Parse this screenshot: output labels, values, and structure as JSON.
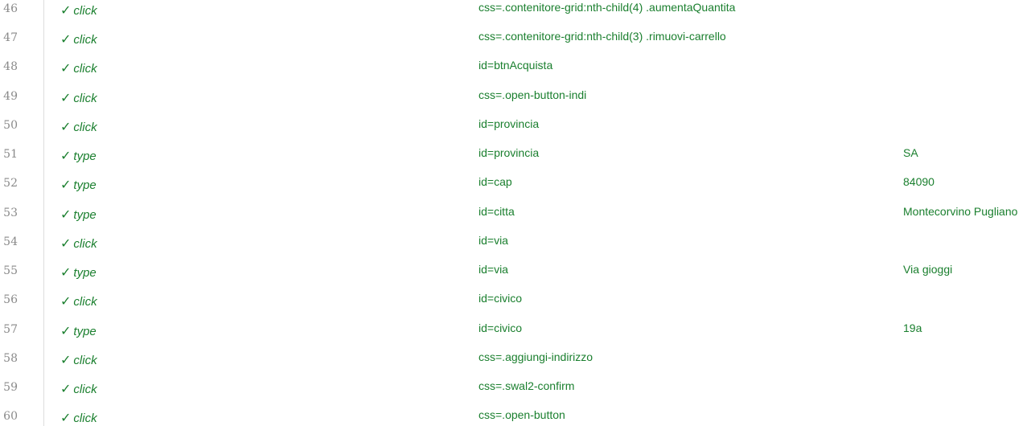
{
  "colors": {
    "pass_text": "#1a7f2e",
    "line_number": "#8a8a8a",
    "gutter_border": "#dddddd"
  },
  "rows": [
    {
      "line": "46",
      "status_icon": "checkmark-icon",
      "command": "click",
      "target": "css=.contenitore-grid:nth-child(4) .aumentaQuantita",
      "value": ""
    },
    {
      "line": "47",
      "status_icon": "checkmark-icon",
      "command": "click",
      "target": "css=.contenitore-grid:nth-child(3) .rimuovi-carrello",
      "value": ""
    },
    {
      "line": "48",
      "status_icon": "checkmark-icon",
      "command": "click",
      "target": "id=btnAcquista",
      "value": ""
    },
    {
      "line": "49",
      "status_icon": "checkmark-icon",
      "command": "click",
      "target": "css=.open-button-indi",
      "value": ""
    },
    {
      "line": "50",
      "status_icon": "checkmark-icon",
      "command": "click",
      "target": "id=provincia",
      "value": ""
    },
    {
      "line": "51",
      "status_icon": "checkmark-icon",
      "command": "type",
      "target": "id=provincia",
      "value": "SA"
    },
    {
      "line": "52",
      "status_icon": "checkmark-icon",
      "command": "type",
      "target": "id=cap",
      "value": "84090"
    },
    {
      "line": "53",
      "status_icon": "checkmark-icon",
      "command": "type",
      "target": "id=citta",
      "value": "Montecorvino Pugliano"
    },
    {
      "line": "54",
      "status_icon": "checkmark-icon",
      "command": "click",
      "target": "id=via",
      "value": ""
    },
    {
      "line": "55",
      "status_icon": "checkmark-icon",
      "command": "type",
      "target": "id=via",
      "value": "Via gioggi"
    },
    {
      "line": "56",
      "status_icon": "checkmark-icon",
      "command": "click",
      "target": "id=civico",
      "value": ""
    },
    {
      "line": "57",
      "status_icon": "checkmark-icon",
      "command": "type",
      "target": "id=civico",
      "value": "19a"
    },
    {
      "line": "58",
      "status_icon": "checkmark-icon",
      "command": "click",
      "target": "css=.aggiungi-indirizzo",
      "value": ""
    },
    {
      "line": "59",
      "status_icon": "checkmark-icon",
      "command": "click",
      "target": "css=.swal2-confirm",
      "value": ""
    },
    {
      "line": "60",
      "status_icon": "checkmark-icon",
      "command": "click",
      "target": "css=.open-button",
      "value": ""
    }
  ]
}
